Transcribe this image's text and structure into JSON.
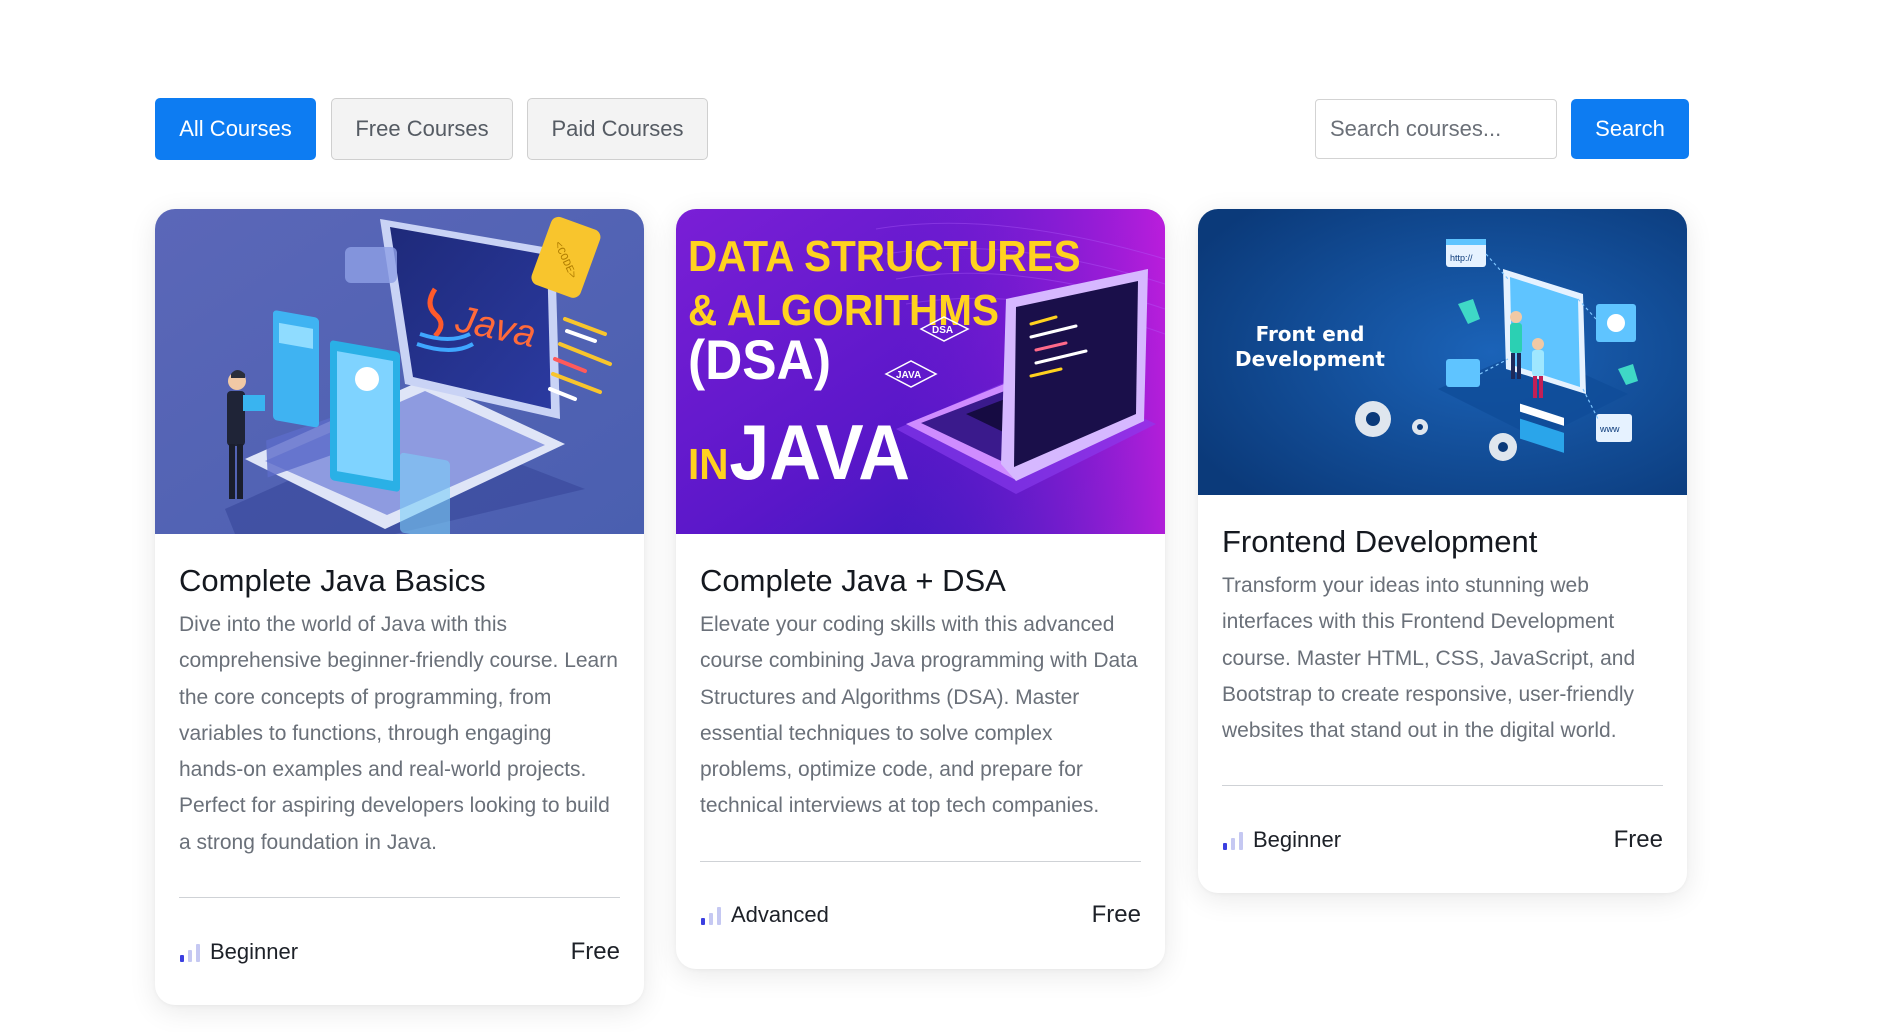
{
  "filters": {
    "all_label": "All Courses",
    "free_label": "Free Courses",
    "paid_label": "Paid Courses"
  },
  "search": {
    "placeholder": "Search courses...",
    "button_label": "Search"
  },
  "courses": [
    {
      "image_theme": "java-laptop-illustration",
      "image_text": "Java",
      "title": "Complete Java Basics",
      "description": "Dive into the world of Java with this comprehensive beginner-friendly course. Learn the core concepts of programming, from variables to functions, through engaging hands-on examples and real-world projects. Perfect for aspiring developers looking to build a strong foundation in Java.",
      "level": "Beginner",
      "price": "Free"
    },
    {
      "image_theme": "dsa-java-banner",
      "image_text": {
        "line1": "DATA STRUCTURES",
        "line2": "& ALGORITHMS",
        "line3": "(DSA)",
        "line4a": "IN",
        "line4b": "JAVA",
        "tag1": "DSA",
        "tag2": "JAVA"
      },
      "title": "Complete Java + DSA",
      "description": "Elevate your coding skills with this advanced course combining Java programming with Data Structures and Algorithms (DSA). Master essential techniques to solve complex problems, optimize code, and prepare for technical interviews at top tech companies.",
      "level": "Advanced",
      "price": "Free"
    },
    {
      "image_theme": "frontend-isometric-illustration",
      "image_text": {
        "line1": "Front end",
        "line2": "Development",
        "tag_http": "http://",
        "tag_www": "www"
      },
      "title": "Frontend Development",
      "description": "Transform your ideas into stunning web interfaces with this Frontend Development course. Master HTML, CSS, JavaScript, and Bootstrap to create responsive, user-friendly websites that stand out in the digital world.",
      "level": "Beginner",
      "price": "Free"
    }
  ],
  "colors": {
    "primary": "#0d7cf2",
    "level_bar_active": "#3b3fe0",
    "level_bar_inactive": "#c5c8f2"
  }
}
